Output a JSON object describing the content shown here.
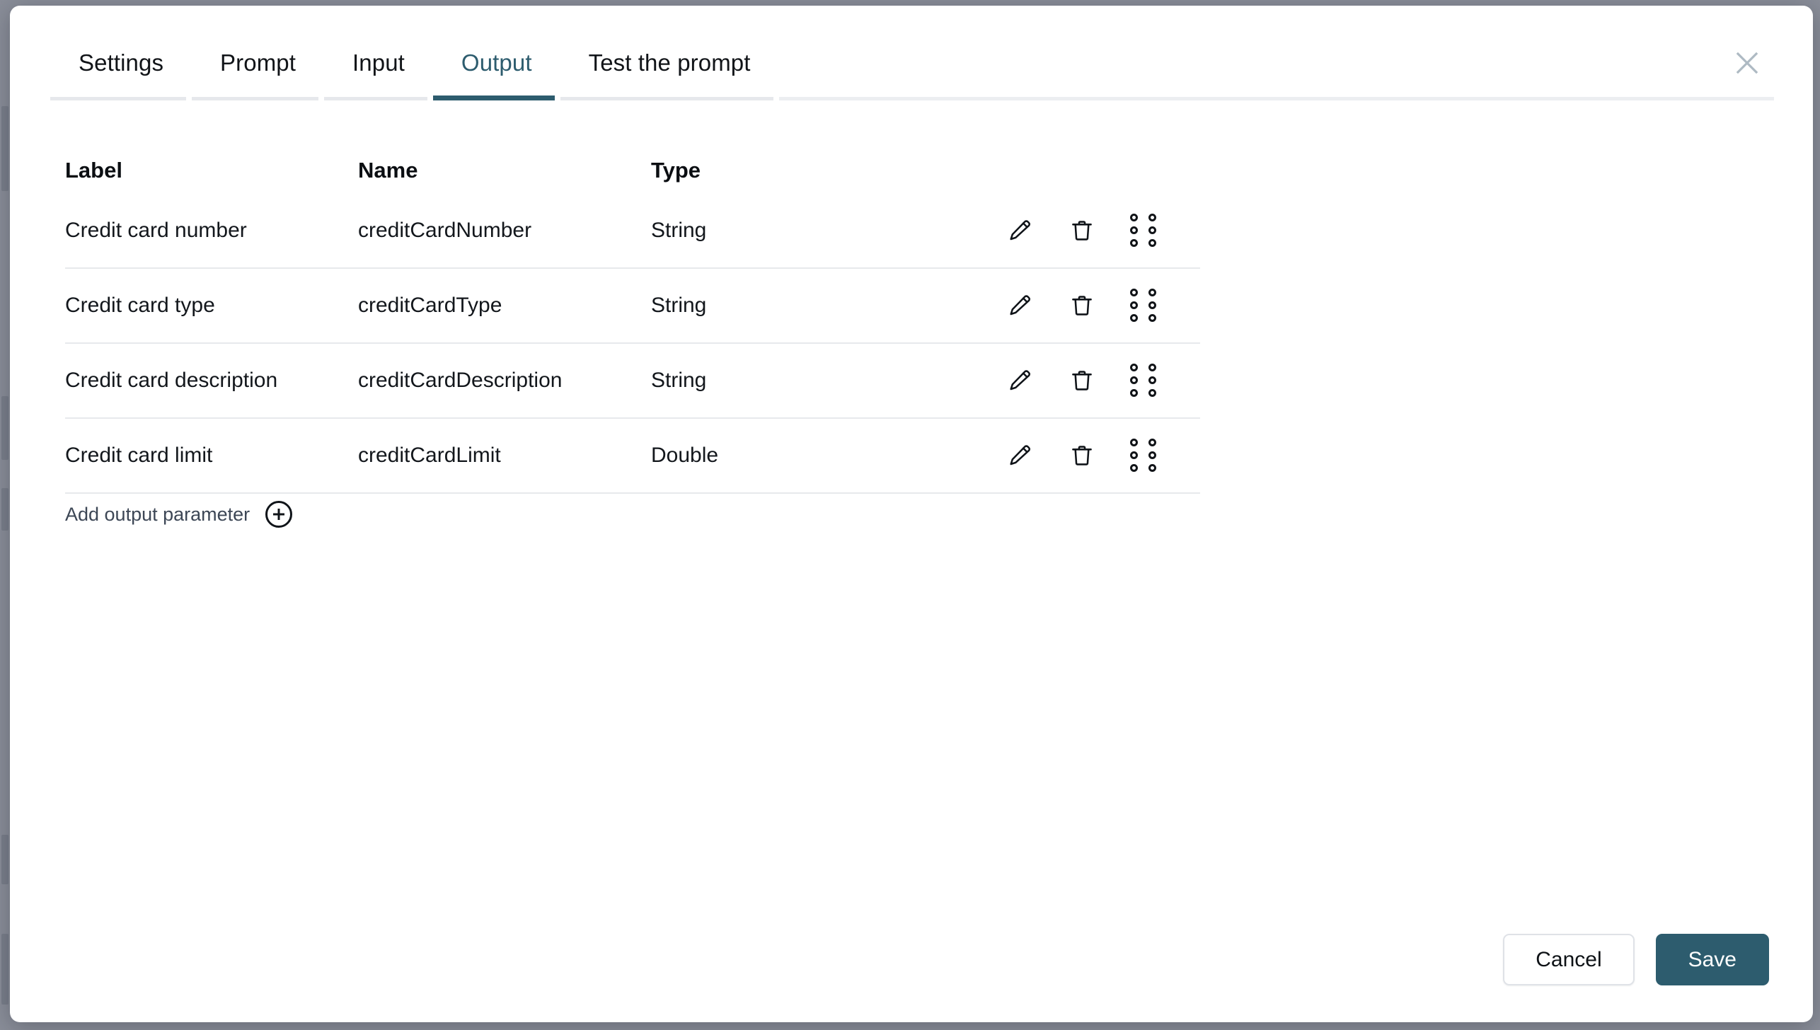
{
  "modal": {
    "close_icon": "close-icon"
  },
  "tabs": [
    {
      "label": "Settings",
      "active": false
    },
    {
      "label": "Prompt",
      "active": false
    },
    {
      "label": "Input",
      "active": false
    },
    {
      "label": "Output",
      "active": true
    },
    {
      "label": "Test the prompt",
      "active": false
    }
  ],
  "table": {
    "headers": {
      "label": "Label",
      "name": "Name",
      "type": "Type"
    },
    "rows": [
      {
        "label": "Credit card number",
        "name": "creditCardNumber",
        "type": "String"
      },
      {
        "label": "Credit card type",
        "name": "creditCardType",
        "type": "String"
      },
      {
        "label": "Credit card description",
        "name": "creditCardDescription",
        "type": "String"
      },
      {
        "label": "Credit card limit",
        "name": "creditCardLimit",
        "type": "Double"
      }
    ],
    "row_actions": {
      "edit_icon": "pencil-icon",
      "delete_icon": "trash-icon",
      "drag_icon": "drag-handle-icon"
    }
  },
  "add_parameter": {
    "label": "Add output parameter",
    "icon": "plus-circle-icon"
  },
  "footer": {
    "cancel_label": "Cancel",
    "save_label": "Save"
  },
  "colors": {
    "accent": "#2d5c6e",
    "backdrop": "#8a8e99",
    "divider": "#e7e9ec",
    "tab_underline": "#e6e8ec",
    "close_icon": "#aebac3",
    "muted_text": "#3d4756"
  }
}
